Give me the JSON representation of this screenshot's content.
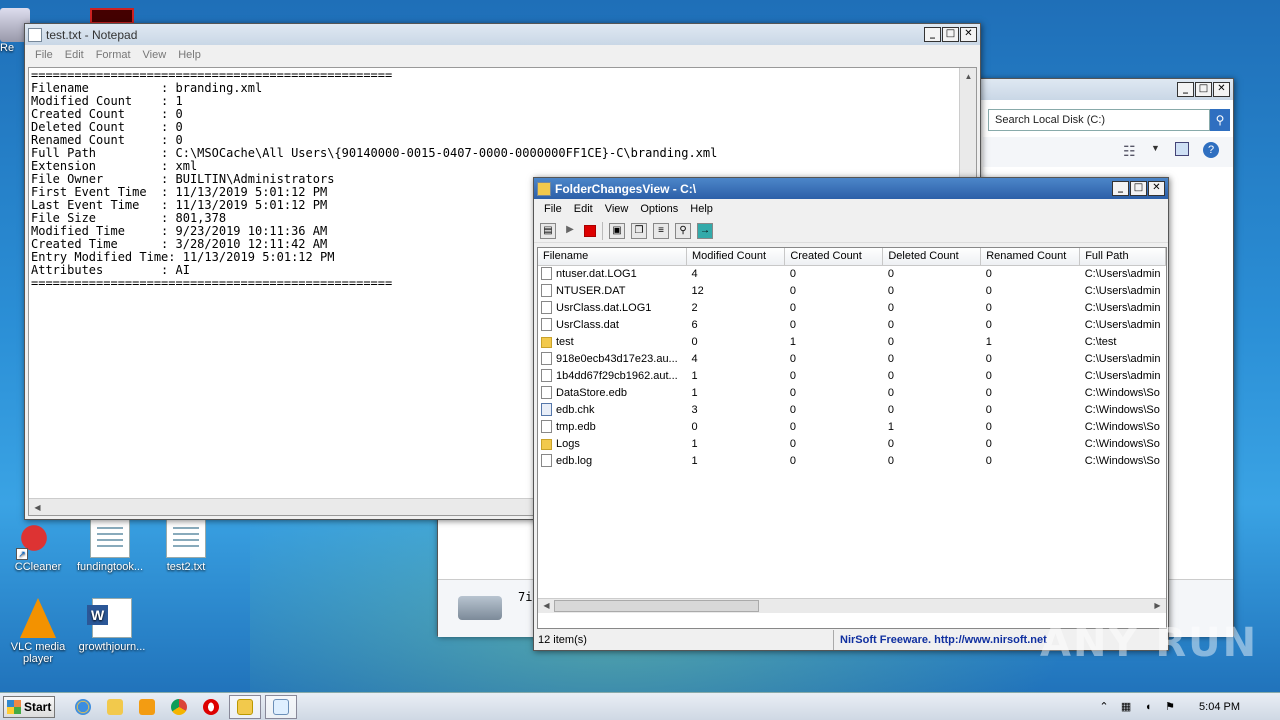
{
  "desktop": {
    "icons": [
      {
        "label": "CCleaner"
      },
      {
        "label": "fundingtook..."
      },
      {
        "label": "test2.txt"
      },
      {
        "label": "VLC media player"
      },
      {
        "label": "growthjourn..."
      }
    ],
    "recycle_label": "Re"
  },
  "notepad": {
    "title": "test.txt - Notepad",
    "menu": [
      "File",
      "Edit",
      "Format",
      "View",
      "Help"
    ],
    "content": "==================================================\nFilename          : branding.xml\nModified Count    : 1\nCreated Count     : 0\nDeleted Count     : 0\nRenamed Count     : 0\nFull Path         : C:\\MSOCache\\All Users\\{90140000-0015-0407-0000-0000000FF1CE}-C\\branding.xml\nExtension         : xml\nFile Owner        : BUILTIN\\Administrators\nFirst Event Time  : 11/13/2019 5:01:12 PM\nLast Event Time   : 11/13/2019 5:01:12 PM\nFile Size         : 801,378\nModified Time     : 9/23/2019 10:11:36 AM\nCreated Time      : 3/28/2010 12:11:42 AM\nEntry Modified Time: 11/13/2019 5:01:12 PM\nAttributes        : AI\n=================================================="
  },
  "explorer": {
    "search_placeholder": "Search Local Disk (C:)",
    "details_text": "7i"
  },
  "fcv": {
    "title": "FolderChangesView - C:\\",
    "menu": [
      "File",
      "Edit",
      "View",
      "Options",
      "Help"
    ],
    "columns": [
      "Filename",
      "Modified Count",
      "Created Count",
      "Deleted Count",
      "Renamed Count",
      "Full Path"
    ],
    "rows": [
      {
        "icon": "file",
        "name": "ntuser.dat.LOG1",
        "mod": "4",
        "cre": "0",
        "del": "0",
        "ren": "0",
        "path": "C:\\Users\\admin"
      },
      {
        "icon": "file",
        "name": "NTUSER.DAT",
        "mod": "12",
        "cre": "0",
        "del": "0",
        "ren": "0",
        "path": "C:\\Users\\admin"
      },
      {
        "icon": "file",
        "name": "UsrClass.dat.LOG1",
        "mod": "2",
        "cre": "0",
        "del": "0",
        "ren": "0",
        "path": "C:\\Users\\admin"
      },
      {
        "icon": "file",
        "name": "UsrClass.dat",
        "mod": "6",
        "cre": "0",
        "del": "0",
        "ren": "0",
        "path": "C:\\Users\\admin"
      },
      {
        "icon": "folder",
        "name": "test",
        "mod": "0",
        "cre": "1",
        "del": "0",
        "ren": "1",
        "path": "C:\\test"
      },
      {
        "icon": "file",
        "name": "918e0ecb43d17e23.au...",
        "mod": "4",
        "cre": "0",
        "del": "0",
        "ren": "0",
        "path": "C:\\Users\\admin"
      },
      {
        "icon": "file",
        "name": "1b4dd67f29cb1962.aut...",
        "mod": "1",
        "cre": "0",
        "del": "0",
        "ren": "0",
        "path": "C:\\Users\\admin"
      },
      {
        "icon": "file",
        "name": "DataStore.edb",
        "mod": "1",
        "cre": "0",
        "del": "0",
        "ren": "0",
        "path": "C:\\Windows\\So"
      },
      {
        "icon": "chk",
        "name": "edb.chk",
        "mod": "3",
        "cre": "0",
        "del": "0",
        "ren": "0",
        "path": "C:\\Windows\\So"
      },
      {
        "icon": "file",
        "name": "tmp.edb",
        "mod": "0",
        "cre": "0",
        "del": "1",
        "ren": "0",
        "path": "C:\\Windows\\So"
      },
      {
        "icon": "folder",
        "name": "Logs",
        "mod": "1",
        "cre": "0",
        "del": "0",
        "ren": "0",
        "path": "C:\\Windows\\So"
      },
      {
        "icon": "file",
        "name": "edb.log",
        "mod": "1",
        "cre": "0",
        "del": "0",
        "ren": "0",
        "path": "C:\\Windows\\So"
      }
    ],
    "status_count": "12 item(s)",
    "status_nirsoft": "NirSoft Freeware.  http://www.nirsoft.net"
  },
  "taskbar": {
    "start_label": "Start",
    "clock": "5:04 PM",
    "apps": [
      "internet-explorer",
      "file-explorer",
      "media-player",
      "chrome",
      "opera",
      "folderchangesview",
      "notepad"
    ]
  },
  "watermark": "ANY RUN"
}
